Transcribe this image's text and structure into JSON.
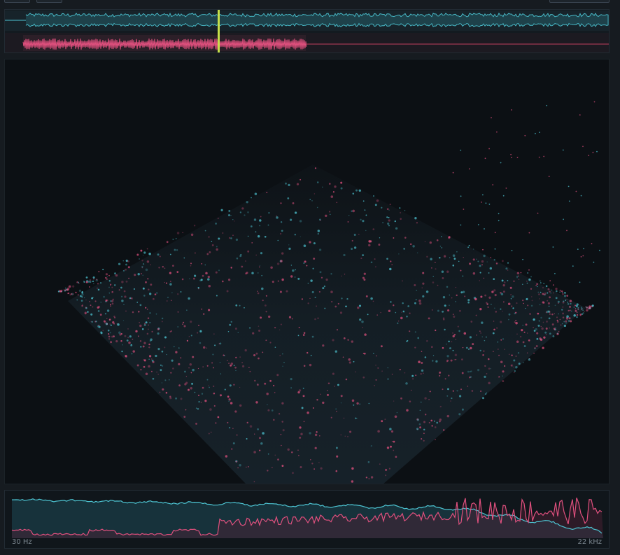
{
  "colors": {
    "background": "#161b20",
    "channel_left": "#4ec6d4",
    "channel_right": "#e0507e",
    "playhead": "#c6e04a"
  },
  "waveform": {
    "playhead_fraction": 0.353,
    "channel_right_extent_fraction": 0.497
  },
  "spectrum": {
    "freq_min_label": "30 Hz",
    "freq_max_label": "22 kHz"
  }
}
